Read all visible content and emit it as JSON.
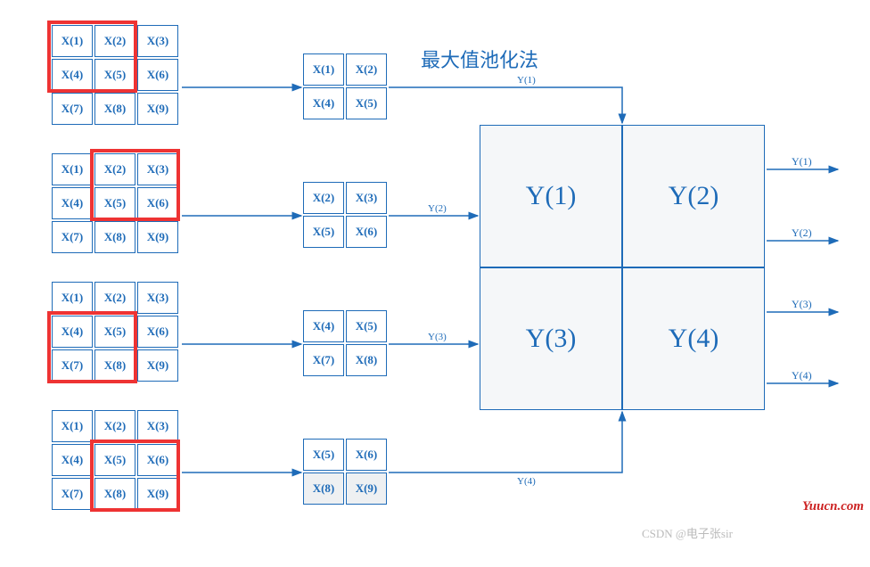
{
  "title": "最大值池化法",
  "watermark": "CSDN @电子张sir",
  "brand": "Yuucn.com",
  "inputGrids": [
    {
      "cells": [
        "X(1)",
        "X(2)",
        "X(3)",
        "X(4)",
        "X(5)",
        "X(6)",
        "X(7)",
        "X(8)",
        "X(9)"
      ],
      "highlight": {
        "row": 0,
        "col": 0
      }
    },
    {
      "cells": [
        "X(1)",
        "X(2)",
        "X(3)",
        "X(4)",
        "X(5)",
        "X(6)",
        "X(7)",
        "X(8)",
        "X(9)"
      ],
      "highlight": {
        "row": 0,
        "col": 1
      }
    },
    {
      "cells": [
        "X(1)",
        "X(2)",
        "X(3)",
        "X(4)",
        "X(5)",
        "X(6)",
        "X(7)",
        "X(8)",
        "X(9)"
      ],
      "highlight": {
        "row": 1,
        "col": 0
      }
    },
    {
      "cells": [
        "X(1)",
        "X(2)",
        "X(3)",
        "X(4)",
        "X(5)",
        "X(6)",
        "X(7)",
        "X(8)",
        "X(9)"
      ],
      "highlight": {
        "row": 1,
        "col": 1
      }
    }
  ],
  "windowGrids": [
    {
      "cells": [
        "X(1)",
        "X(2)",
        "X(4)",
        "X(5)"
      ],
      "shaded": []
    },
    {
      "cells": [
        "X(2)",
        "X(3)",
        "X(5)",
        "X(6)"
      ],
      "shaded": []
    },
    {
      "cells": [
        "X(4)",
        "X(5)",
        "X(7)",
        "X(8)"
      ],
      "shaded": []
    },
    {
      "cells": [
        "X(5)",
        "X(6)",
        "X(8)",
        "X(9)"
      ],
      "shaded": [
        2,
        3
      ]
    }
  ],
  "outputGrid": [
    "Y(1)",
    "Y(2)",
    "Y(3)",
    "Y(4)"
  ],
  "arrowLabels": [
    "Y(1)",
    "Y(2)",
    "Y(3)",
    "Y(4)"
  ],
  "outputLabels": [
    "Y(1)",
    "Y(2)",
    "Y(3)",
    "Y(4)"
  ],
  "chart_data": {
    "type": "table",
    "description": "Max-pooling illustration: 3x3 input with 2x2 sliding window producing 2x2 output",
    "input": [
      [
        "X(1)",
        "X(2)",
        "X(3)"
      ],
      [
        "X(4)",
        "X(5)",
        "X(6)"
      ],
      [
        "X(7)",
        "X(8)",
        "X(9)"
      ]
    ],
    "windows": [
      {
        "region": [
          [
            "X(1)",
            "X(2)"
          ],
          [
            "X(4)",
            "X(5)"
          ]
        ],
        "output": "Y(1)"
      },
      {
        "region": [
          [
            "X(2)",
            "X(3)"
          ],
          [
            "X(5)",
            "X(6)"
          ]
        ],
        "output": "Y(2)"
      },
      {
        "region": [
          [
            "X(4)",
            "X(5)"
          ],
          [
            "X(7)",
            "X(8)"
          ]
        ],
        "output": "Y(3)"
      },
      {
        "region": [
          [
            "X(5)",
            "X(6)"
          ],
          [
            "X(8)",
            "X(9)"
          ]
        ],
        "output": "Y(4)"
      }
    ],
    "output": [
      [
        "Y(1)",
        "Y(2)"
      ],
      [
        "Y(3)",
        "Y(4)"
      ]
    ],
    "operation": "max"
  }
}
